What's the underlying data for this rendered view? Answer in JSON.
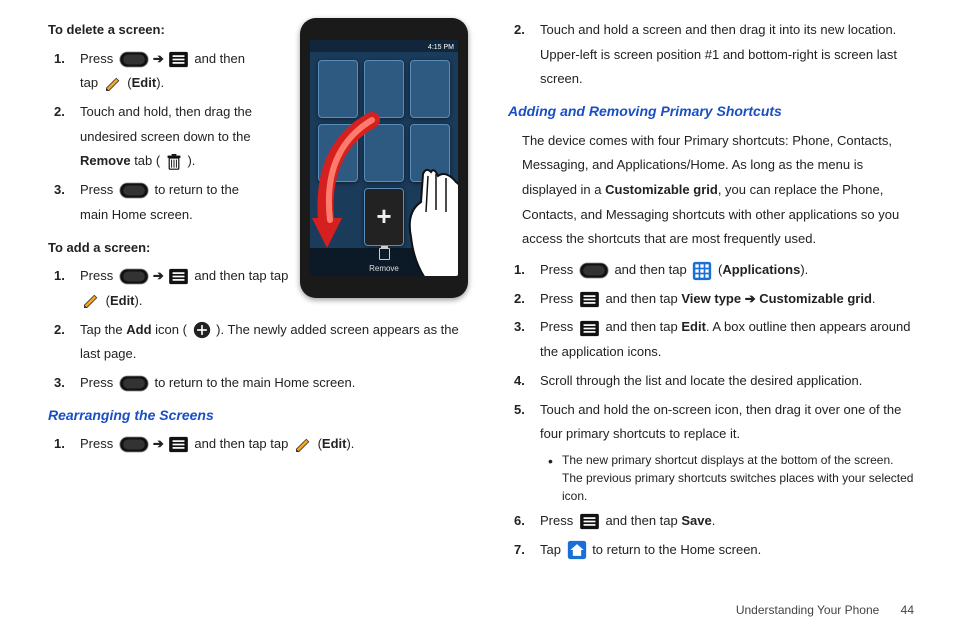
{
  "footer": {
    "section": "Understanding Your Phone",
    "page": "44"
  },
  "left": {
    "delete_heading": "To delete a screen:",
    "d1_a": "Press ",
    "d1_b": " and then tap ",
    "d1_c": " (",
    "d1_edit": "Edit",
    "d1_d": ").",
    "d2_a": "Touch and hold, then drag the undesired screen down to the ",
    "d2_remove": "Remove",
    "d2_b": " tab ( ",
    "d2_c": " ).",
    "d3_a": "Press ",
    "d3_b": " to return to the main Home screen.",
    "add_heading": "To add a screen:",
    "a1_a": "Press ",
    "a1_b": " and then tap tap ",
    "a1_c": " (",
    "a1_edit": "Edit",
    "a1_d": ").",
    "a2_a": "Tap the ",
    "a2_addword": "Add",
    "a2_b": " icon ( ",
    "a2_c": " ). The newly added screen appears as the last page.",
    "a3_a": "Press ",
    "a3_b": " to return to the main Home screen.",
    "rearr_heading": "Rearranging the Screens",
    "r1_a": "Press ",
    "r1_b": " and then tap tap ",
    "r1_c": " (",
    "r1_edit": "Edit",
    "r1_d": ").",
    "phone_time": "4:15 PM",
    "phone_remove": "Remove"
  },
  "right": {
    "r2_a": "Touch and hold a screen and then drag it into its new location. Upper-left is screen position #1 and bottom-right is screen last screen.",
    "shortcut_heading": "Adding and Removing Primary Shortcuts",
    "intro_a": "The device comes with four Primary shortcuts: Phone, Contacts, Messaging, and Applications/Home. As long as the menu is displayed in a ",
    "intro_grid": "Customizable grid",
    "intro_b": ", you can replace the Phone, Contacts, and Messaging shortcuts with other applications so you access the shortcuts that are most frequently used.",
    "s1_a": "Press ",
    "s1_b": " and then tap ",
    "s1_c": " (",
    "s1_apps": "Applications",
    "s1_d": ").",
    "s2_a": "Press ",
    "s2_b": " and then tap ",
    "s2_view": "View type",
    "s2_c": " ➔ ",
    "s2_grid": "Customizable grid",
    "s2_d": ".",
    "s3_a": "Press ",
    "s3_b": " and then tap ",
    "s3_edit": "Edit",
    "s3_c": ". A box outline then appears around the application icons.",
    "s4": "Scroll through the list and locate the desired application.",
    "s5": "Touch and hold the on-screen icon, then drag it over one of the four primary shortcuts to replace it.",
    "s5b": "The new primary shortcut displays at the bottom of the screen. The previous primary shortcuts switches places with your selected icon.",
    "s6_a": "Press ",
    "s6_b": " and then tap ",
    "s6_save": "Save",
    "s6_c": ".",
    "s7_a": "Tap ",
    "s7_b": " to return to the Home screen."
  }
}
